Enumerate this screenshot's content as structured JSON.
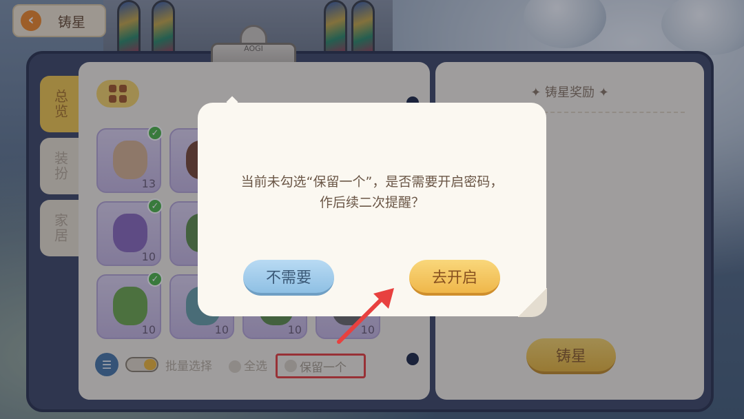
{
  "header": {
    "title": "铸星"
  },
  "clip": {
    "label": "AOGI"
  },
  "side_tabs": [
    {
      "label": "总览",
      "active": true
    },
    {
      "label": "装扮",
      "active": false
    },
    {
      "label": "家居",
      "active": false
    }
  ],
  "items": [
    {
      "count": "13",
      "checked": true,
      "color": "#d9b391"
    },
    {
      "count": "",
      "checked": false,
      "color": "#7a4a36"
    },
    {
      "count": "10",
      "checked": true,
      "color": "#8b6bbd"
    },
    {
      "count": "",
      "checked": false,
      "color": "#5f8f4c"
    },
    {
      "count": "10",
      "checked": true,
      "color": "#6fa84e"
    },
    {
      "count": "10",
      "checked": false,
      "color": "#6aa0a8"
    },
    {
      "count": "10",
      "checked": false,
      "color": "#5f8f4c"
    },
    {
      "count": "10",
      "checked": false,
      "color": "#6b6b6b"
    }
  ],
  "bottom_bar": {
    "batch_select": "批量选择",
    "select_all": "全选",
    "keep_one": "保留一个"
  },
  "reward": {
    "title": "✦ 铸星奖励 ✦",
    "forge_button": "铸星"
  },
  "dialog": {
    "message": "当前未勾选“保留一个”，是否需要开启密码，作后续二次提醒？",
    "cancel": "不需要",
    "confirm": "去开启"
  },
  "colors": {
    "highlight": "#e8413f",
    "accent": "#f3c94f"
  }
}
